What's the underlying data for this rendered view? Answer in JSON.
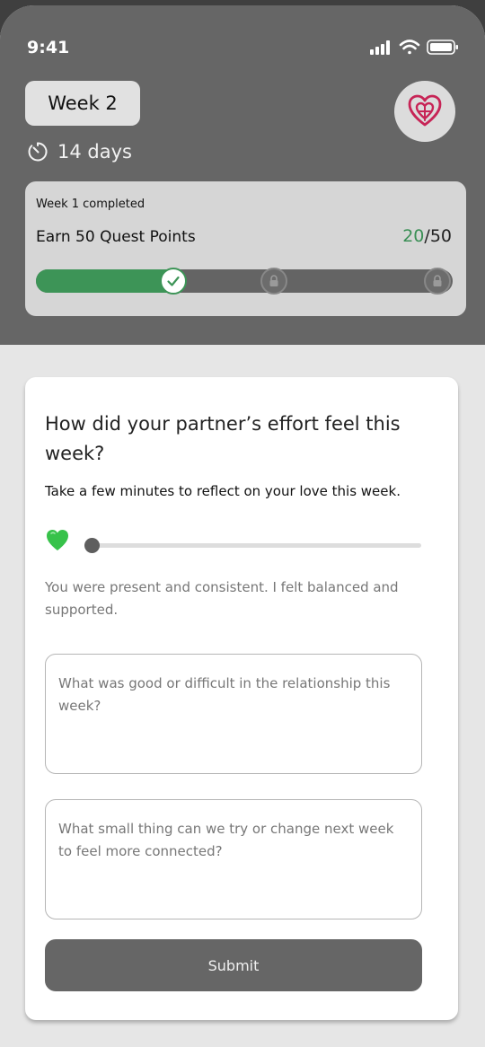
{
  "status_bar": {
    "time": "9:41"
  },
  "header": {
    "week_label": "Week 2",
    "days_label": "14 days",
    "logo_icon": "heart-knot-icon"
  },
  "quest": {
    "status_text": "Week 1 completed",
    "title": "Earn 50 Quest Points",
    "points_current": "20",
    "points_separator": "/",
    "points_total": "50",
    "progress_fraction": 0.33,
    "milestones": [
      "completed",
      "locked",
      "locked"
    ],
    "colors": {
      "accent": "#3d9457",
      "track": "#646464"
    }
  },
  "form": {
    "question": "How did your partner’s effort feel this week?",
    "subtitle": "Take a few minutes to reflect on your love this week.",
    "rating_emoji": "💚",
    "slider_value": 0.0,
    "feedback_text": "You were present and consistent. I felt balanced and supported.",
    "good_difficult_placeholder": "What was good or difficult in the relationship this week?",
    "change_placeholder": "What small thing can we try or change next week to feel more connected?",
    "submit_label": "Submit"
  }
}
